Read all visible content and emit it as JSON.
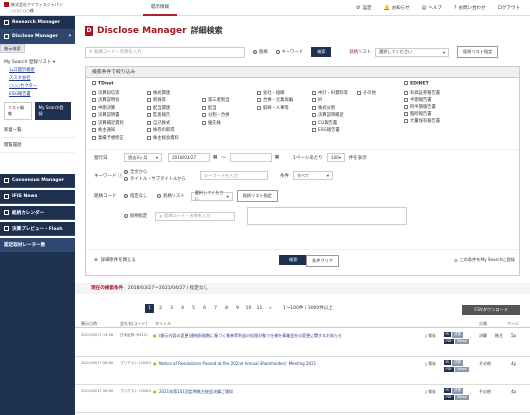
{
  "topbar": {
    "company": [
      "株式会社アイフィスジャパン",
      "○○○ ○○様"
    ],
    "tab": "開示情報",
    "links": [
      {
        "icon": "gear-icon",
        "label": "設定"
      },
      {
        "icon": "bell-icon",
        "label": "お知らせ"
      },
      {
        "icon": "book-icon",
        "label": "ヘルプ"
      },
      {
        "icon": "question-icon",
        "label": "お問い合わせ"
      },
      {
        "icon": "logout-icon",
        "label": "ログアウト"
      }
    ]
  },
  "sidebar": {
    "research": "Research Manager",
    "disclose": "Disclose Manager",
    "sub_selected": "開示検索",
    "mysearch": "My Search 登録リスト",
    "mysearch_items": [
      "ムロ開示検索",
      "ススネ会社",
      "○○○セクター",
      "ESG報告書"
    ],
    "btn_list": "リスト編集",
    "btn_register": "My Search登録",
    "plain": [
      "新着一覧",
      "閲覧履歴"
    ],
    "bottom": [
      "Consensus Manager",
      "IFIS News",
      "銘柄カレンダー",
      "決算プレビュー・Flash",
      "認定取材レーター数"
    ]
  },
  "main": {
    "title_brand": "Disclose Manager",
    "title_page": "詳細検索",
    "search_placeholder": "銘柄コード・名称を入力",
    "radio_name": "銘柄",
    "radio_keyword": "キーワード",
    "search_btn": "検索",
    "list_label": "銘柄リスト",
    "list_select": "選択してください",
    "list_btn": "銘柄リスト指定",
    "panel_title": "検索条件で絞り込み",
    "tdnet_label": "TDnet",
    "edinet_label": "EDINET",
    "tdnet_cols": [
      [
        "決算短信等",
        "決算説明会",
        "中期決算",
        "決算説明書",
        "決算補足資料",
        "株主通知",
        "業績予想修正"
      ],
      [
        "株式関連",
        "新株等",
        "配当関連",
        "監査報告",
        "自己株式",
        "株券の取得",
        "株主総会資料"
      ],
      [
        "",
        "第三者割当",
        "配当",
        "分割・合併",
        "優先株",
        "",
        ""
      ],
      [
        "会社・組織",
        "合併・企業再編",
        "取締・人事等",
        "",
        "",
        "",
        ""
      ],
      [
        "中計・IR資料等",
        "IR",
        "株式分割",
        "決算説明補足",
        "CG報告書",
        "ESG報告書",
        ""
      ],
      [
        "その他",
        "",
        "",
        "",
        "",
        "",
        ""
      ]
    ],
    "edinet_items": [
      "有価証券報告書",
      "半期報告書",
      "四半期報告書",
      "臨時報告書",
      "大量保有報告書"
    ],
    "period_label": "発行日",
    "period_select": "過去3ヶ月",
    "date_from": "2018/03/27",
    "date_to": "",
    "per_page_label": "1ページあたり",
    "per_page": "100",
    "per_page_suffix": "件を表示",
    "keyword_label": "キーワード",
    "kw_opt1": "全文から",
    "kw_opt2": "タイトル・サブタイトルから",
    "kw_placeholder": "キーワードを入力",
    "kw_cond_label": "条件",
    "kw_cond": "すべて",
    "code_label": "銘柄コード",
    "code_opt1": "指定なし",
    "code_opt2": "銘柄リスト",
    "code_select": "選択してください",
    "code_btn": "銘柄リスト指定",
    "code_opt3": "銘柄指定",
    "code_placeholder": "銘柄コード・名称を入力",
    "save_cond": "詳細条件を閉じる",
    "search_btn2": "検索",
    "clear_btn": "条件クリア",
    "register_label": "この条件をMy Searchに登録"
  },
  "results": {
    "header_label": "現在の検索条件",
    "header_value": "2018/03/27～2021/04/27 / 指定なし",
    "pages": [
      "1",
      "2",
      "3",
      "4",
      "5",
      "6",
      "7",
      "8",
      "9",
      "10",
      "11",
      "»"
    ],
    "range": "1〜100件 / 3000件以上",
    "download": "CSVダウンロード",
    "columns": [
      "開示日時",
      "会社名(コード)",
      "タイトル",
      "分類",
      "ページ"
    ],
    "rows": [
      {
        "date": "2021/05/17 13:06",
        "company": "日本証券 (9412)",
        "title": "(開示内容の変更)連結財務数に基づく株券等利益の処理対象で仕様を事業会社の変更に関するお知らせ",
        "flag": "保存",
        "cat": "決算",
        "cat2": "株主",
        "pages": "5p"
      },
      {
        "date": "2021/05/17 06:00",
        "company": "プリテスト (2040)",
        "title": "Notice of Resolutions Passed at the 202nd Annual Shareholders' Meeting 2021",
        "flag": "保存",
        "cat": "その他",
        "cat2": "",
        "pages": "4p"
      },
      {
        "date": "2021/05/17 06:00",
        "company": "プリテスト (2040)",
        "title": "2021年第101回定時株主総会決議ご通知",
        "flag": "保存",
        "cat": "その他",
        "cat2": "",
        "pages": "4p"
      }
    ]
  }
}
